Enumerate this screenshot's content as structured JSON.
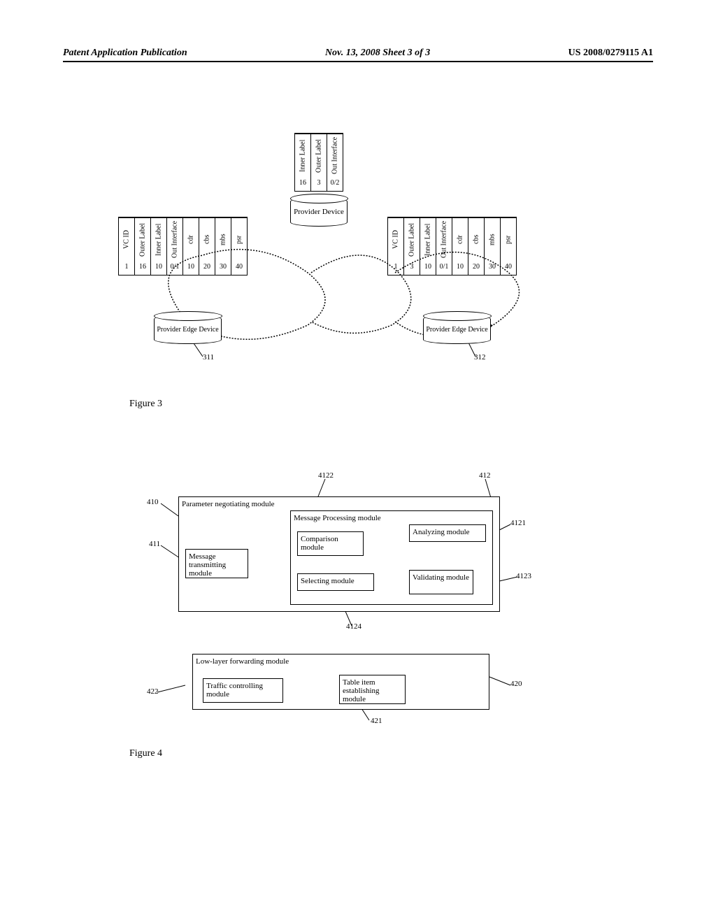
{
  "header": {
    "left": "Patent Application Publication",
    "center": "Nov. 13, 2008  Sheet 3 of 3",
    "right": "US 2008/0279115 A1"
  },
  "figure3": {
    "label": "Figure 3",
    "provider_device": "Provider Device",
    "edge_left": "Provider Edge Device",
    "edge_left_ref": "311",
    "edge_right": "Provider Edge Device",
    "edge_right_ref": "312",
    "top_table": {
      "headers": [
        "Inner Label",
        "Outer Label",
        "Out Interface"
      ],
      "values": [
        "16",
        "3",
        "0/2"
      ]
    },
    "left_table": {
      "headers": [
        "VC ID",
        "Outer Label",
        "Inner Label",
        "Out Interface",
        "cdr",
        "cbs",
        "mbs",
        "psr"
      ],
      "values": [
        "1",
        "16",
        "10",
        "0/1",
        "10",
        "20",
        "30",
        "40"
      ]
    },
    "right_table": {
      "headers": [
        "VC ID",
        "Outer Label",
        "Inner Label",
        "Out Interface",
        "cdr",
        "cbs",
        "mbs",
        "psr"
      ],
      "values": [
        "1",
        "3",
        "10",
        "0/1",
        "10",
        "20",
        "30",
        "40"
      ]
    }
  },
  "figure4": {
    "label": "Figure 4",
    "parameter_negotiating": "Parameter negotiating module",
    "message_transmitting": "Message transmitting module",
    "message_processing": "Message Processing module",
    "comparison": "Comparison module",
    "analyzing": "Analyzing module",
    "selecting": "Selecting module",
    "validating": "Validating module",
    "low_layer": "Low-layer forwarding module",
    "traffic_controlling": "Traffic controlling module",
    "table_item": "Table item establishing module",
    "ref410": "410",
    "ref411": "411",
    "ref412": "412",
    "ref4121": "4121",
    "ref4122": "4122",
    "ref4123": "4123",
    "ref4124": "4124",
    "ref420": "420",
    "ref421": "421",
    "ref422": "422"
  }
}
